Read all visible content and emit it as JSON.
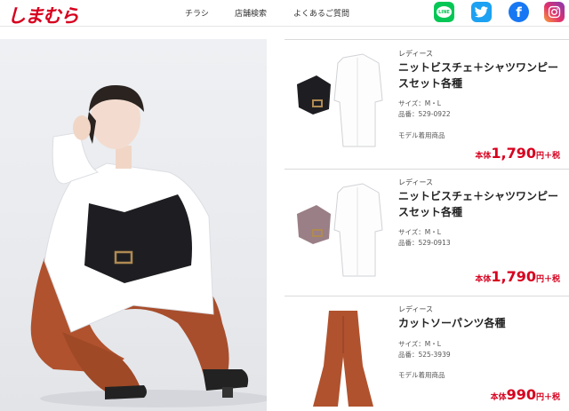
{
  "header": {
    "logo": "しまむら",
    "nav": [
      "チラシ",
      "店舗検索",
      "よくあるご質問"
    ],
    "social": [
      {
        "name": "line",
        "label": "LINE",
        "color": "#06c755"
      },
      {
        "name": "twitter",
        "label": "",
        "color": "#1da1f2"
      },
      {
        "name": "facebook",
        "label": "f",
        "color": "#1877f2"
      },
      {
        "name": "instagram",
        "label": "",
        "color": "#e1306c"
      }
    ]
  },
  "products": [
    {
      "category": "レディース",
      "name": "ニットビスチェ＋シャツワンピースセット各種",
      "size": "サイズ：M・L",
      "code": "品番：529-0922",
      "model_note": "モデル着用商品",
      "price_prefix": "本体",
      "price": "1,790",
      "price_suffix": "円＋税",
      "vest_color": "#1e1e22"
    },
    {
      "category": "レディース",
      "name": "ニットビスチェ＋シャツワンピースセット各種",
      "size": "サイズ：M・L",
      "code": "品番：529-0913",
      "model_note": "",
      "price_prefix": "本体",
      "price": "1,790",
      "price_suffix": "円＋税",
      "vest_color": "#9a7f86"
    },
    {
      "category": "レディース",
      "name": "カットソーパンツ各種",
      "size": "サイズ：M・L",
      "code": "品番：525-3939",
      "model_note": "モデル着用商品",
      "price_prefix": "本体",
      "price": "990",
      "price_suffix": "円＋税",
      "pants_color": "#b0522e"
    }
  ],
  "colors": {
    "brand_red": "#d7001e",
    "divider": "#dadada"
  }
}
